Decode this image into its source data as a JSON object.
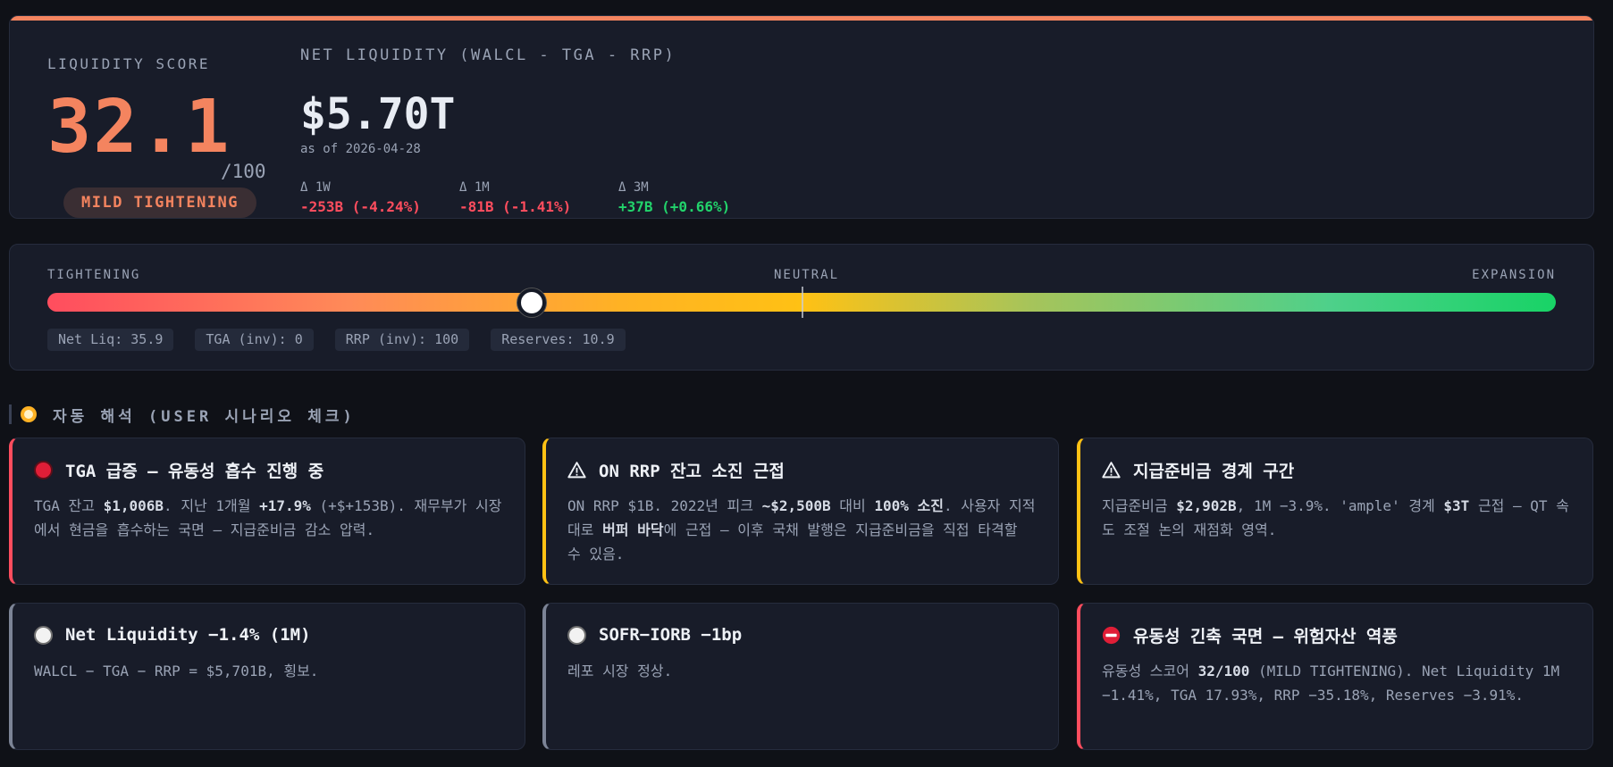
{
  "score": {
    "label": "LIQUIDITY SCORE",
    "value": "32.1",
    "max": "/100",
    "regime": "MILD TIGHTENING",
    "accent_color": "#f4845f"
  },
  "net_liquidity": {
    "label": "NET LIQUIDITY (WALCL - TGA - RRP)",
    "value": "$5.70T",
    "as_of": "as of 2026-04-28",
    "deltas": [
      {
        "label": "Δ 1W",
        "value": "-253B (-4.24%)",
        "direction": "negative"
      },
      {
        "label": "Δ 1M",
        "value": "-81B (-1.41%)",
        "direction": "negative"
      },
      {
        "label": "Δ 3M",
        "value": "+37B (+0.66%)",
        "direction": "positive"
      }
    ]
  },
  "gauge": {
    "left_label": "TIGHTENING",
    "center_label": "NEUTRAL",
    "right_label": "EXPANSION",
    "position_percent": 32.1,
    "chips": [
      "Net Liq: 35.9",
      "TGA (inv): 0",
      "RRP (inv): 100",
      "Reserves: 10.9"
    ]
  },
  "section": {
    "title": "자동 해석 (USER 시나리오 체크)",
    "icon": "clock-icon"
  },
  "cards": [
    {
      "severity": "red",
      "icon": "red-circle-icon",
      "title": "TGA 급증 — 유동성 흡수 진행 중",
      "body_html": "TGA 잔고 <b>$1,006B</b>. 지난 1개월 <b>+17.9%</b> (+$+153B). 재무부가 시장에서 현금을 흡수하는 국면 — 지급준비금 감소 압력."
    },
    {
      "severity": "yellow",
      "icon": "warning-icon",
      "title": "ON RRP 잔고 소진 근접",
      "body_html": "ON RRP $1B. 2022년 피크 <b>~$2,500B</b> 대비 <b>100% 소진</b>. 사용자 지적대로 <b>버퍼 바닥</b>에 근접 — 이후 국채 발행은 지급준비금을 직접 타격할 수 있음."
    },
    {
      "severity": "yellow",
      "icon": "warning-icon",
      "title": "지급준비금 경계 구간",
      "body_html": "지급준비금 <b>$2,902B</b>, 1M −3.9%. 'ample' 경계 <b>$3T</b> 근접 — QT 속도 조절 논의 재점화 영역."
    },
    {
      "severity": "gray",
      "icon": "white-circle-icon",
      "title": "Net Liquidity −1.4% (1M)",
      "body_html": "WALCL − TGA − RRP = $5,701B, 횡보."
    },
    {
      "severity": "gray",
      "icon": "white-circle-icon",
      "title": "SOFR−IORB −1bp",
      "body_html": "레포 시장 정상."
    },
    {
      "severity": "red",
      "icon": "no-entry-icon",
      "title": "유동성 긴축 국면 — 위험자산 역풍",
      "body_html": "유동성 스코어 <b>32/100</b> (MILD TIGHTENING). Net Liquidity 1M −1.41%, TGA 17.93%, RRP −35.18%, Reserves −3.91%."
    }
  ]
}
